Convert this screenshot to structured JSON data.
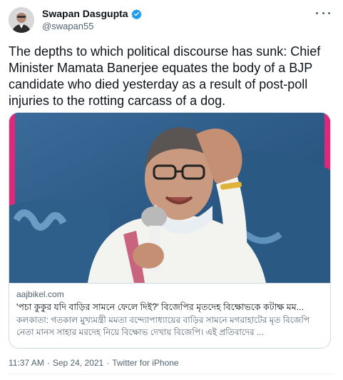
{
  "author": {
    "display_name": "Swapan Dasgupta",
    "handle": "@swapan55",
    "verified": true
  },
  "icons": {
    "verified": "verified-badge-icon",
    "more": "more-options-icon"
  },
  "tweet": {
    "text": "The depths to which political discourse has sunk: Chief Minister Mamata Banerjee equates the body of a BJP candidate who died yesterday as a result of post-poll injuries to the rotting carcass of a dog."
  },
  "link_card": {
    "domain": "aajbikel.com",
    "title": "'পচা কুকুর যদি বাড়ির সামনে ফেলে দিই?' বিজেপির মৃতদেহ বিক্ষোভকে কটাক্ষ মম...",
    "description": "কলকাতা: গতকাল মুখ্যমন্ত্রী মমতা বন্দ্যোপাধ্যায়ের বাড়ির সামনে মগরাহাটের মৃত বিজেপি নেতা মানস সাহার মরদেহ নিয়ে বিক্ষোভ দেখায় বিজেপি। এই প্রতিবাদের ..."
  },
  "meta": {
    "time": "11:37 AM",
    "separator": "·",
    "date": "Sep 24, 2021",
    "separator2": "·",
    "source": "Twitter for iPhone"
  },
  "colors": {
    "verified": "#1d9bf0",
    "text": "#0f1419",
    "secondary": "#536471",
    "border": "#cfd9de"
  }
}
